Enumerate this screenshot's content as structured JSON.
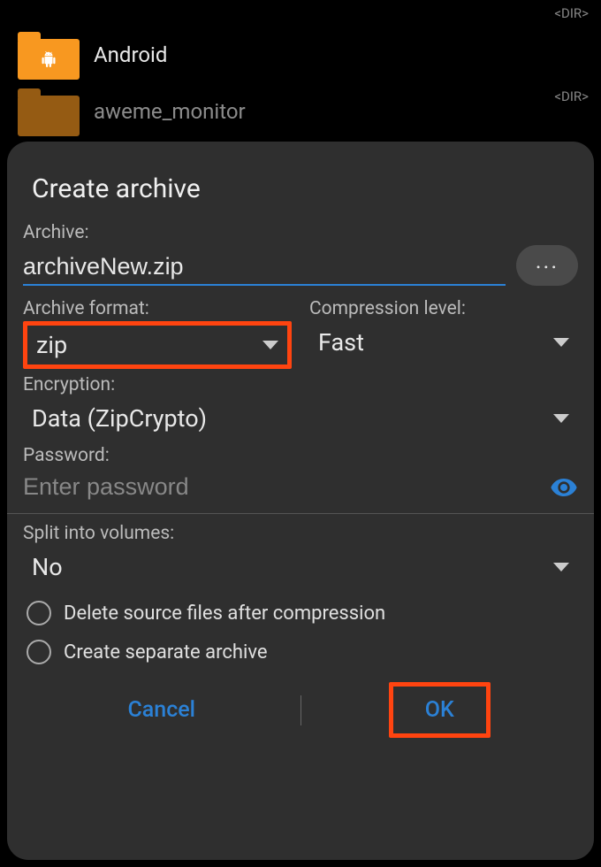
{
  "background": {
    "items": [
      {
        "label": "Android"
      },
      {
        "label": "aweme_monitor"
      }
    ],
    "dir_marker": "<DIR>"
  },
  "dialog": {
    "title": "Create archive",
    "archive_label": "Archive:",
    "archive_value": "archiveNew.zip",
    "browse_dots": "...",
    "format_label": "Archive format:",
    "format_value": "zip",
    "compression_label": "Compression level:",
    "compression_value": "Fast",
    "encryption_label": "Encryption:",
    "encryption_value": "Data (ZipCrypto)",
    "password_label": "Password:",
    "password_placeholder": "Enter password",
    "split_label": "Split into volumes:",
    "split_value": "No",
    "delete_source_label": "Delete source files after compression",
    "separate_archive_label": "Create separate archive",
    "cancel_label": "Cancel",
    "ok_label": "OK"
  },
  "highlights": {
    "color": "#ff4410",
    "targets": [
      "archive-format-dropdown",
      "ok-button"
    ]
  }
}
